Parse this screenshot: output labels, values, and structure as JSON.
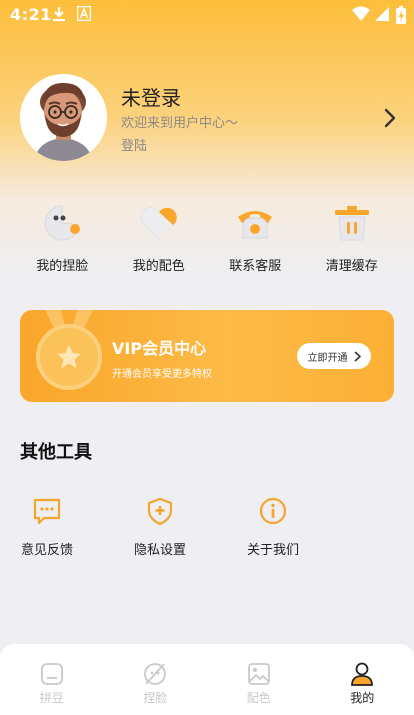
{
  "status_bar": {
    "time": "4:21"
  },
  "profile": {
    "name": "未登录",
    "welcome": "欢迎来到用户中心～",
    "login": "登陆"
  },
  "quick_actions": [
    {
      "label": "我的捏脸",
      "icon": "face-pacman-icon"
    },
    {
      "label": "我的配色",
      "icon": "heart-palette-icon"
    },
    {
      "label": "联系客服",
      "icon": "phone-icon"
    },
    {
      "label": "清理缓存",
      "icon": "trash-icon"
    }
  ],
  "vip": {
    "title": "VIP会员中心",
    "subtitle": "开通会员享受更多特权",
    "button": "立即开通"
  },
  "tools": {
    "title": "其他工具",
    "items": [
      {
        "label": "意见反馈",
        "icon": "feedback-icon"
      },
      {
        "label": "隐私设置",
        "icon": "privacy-shield-icon"
      },
      {
        "label": "关于我们",
        "icon": "info-icon"
      }
    ]
  },
  "tab_bar": [
    {
      "label": "拼豆",
      "icon": "beads-icon",
      "active": false
    },
    {
      "label": "捏脸",
      "icon": "face-icon",
      "active": false
    },
    {
      "label": "配色",
      "icon": "image-icon",
      "active": false
    },
    {
      "label": "我的",
      "icon": "user-icon",
      "active": true
    }
  ],
  "colors": {
    "accent": "#FCA52B",
    "tool_icon": "#F6A430",
    "tab_inactive": "#C9C9C9"
  }
}
